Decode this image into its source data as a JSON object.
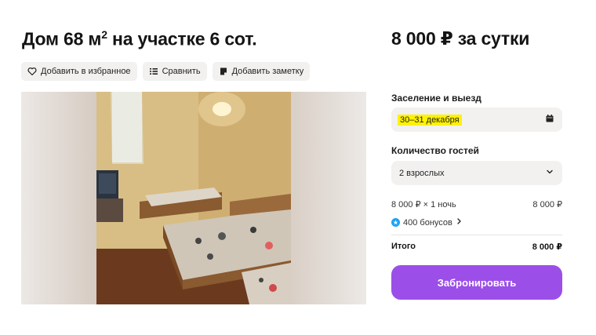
{
  "listing": {
    "title_main": "Дом 68 м",
    "title_sup": "2",
    "title_rest": " на участке 6 сот.",
    "price": "8 000 ₽ за сутки"
  },
  "actions": [
    {
      "label": "Добавить в избранное",
      "icon": "heart-icon"
    },
    {
      "label": "Сравнить",
      "icon": "compare-icon"
    },
    {
      "label": "Добавить заметку",
      "icon": "note-icon"
    }
  ],
  "booking": {
    "dates_label": "Заселение и выезд",
    "dates_value": "30–31 декабря",
    "dates_icon": "calendar-icon",
    "guests_label": "Количество гостей",
    "guests_value": "2 взрослых",
    "guests_icon": "chevron-down-icon",
    "nights_label": "8 000 ₽ × 1 ночь",
    "nights_amount": "8 000 ₽",
    "bonus_text": "400 бонусов",
    "total_label": "Итого",
    "total_amount": "8 000 ₽",
    "book_button": "Забронировать"
  },
  "colors": {
    "accent": "#9b4fe8",
    "highlight": "#fff200",
    "chip_bg": "#f2f1f0",
    "bonus": "#1fa3f5"
  }
}
